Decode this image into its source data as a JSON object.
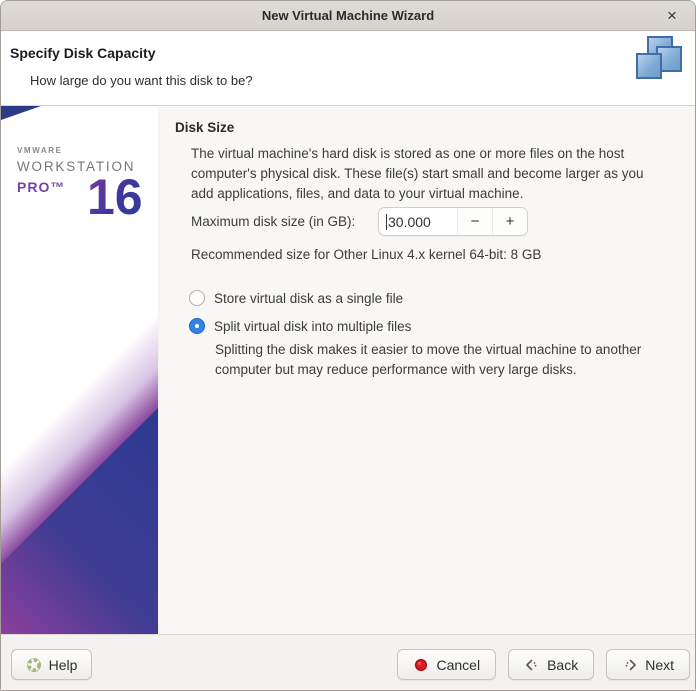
{
  "window": {
    "title": "New Virtual Machine Wizard",
    "close_icon": "×"
  },
  "header": {
    "title": "Specify Disk Capacity",
    "subtitle": "How large do you want this disk to be?"
  },
  "sidebar": {
    "brand_vmware": "VMWARE",
    "brand_workstation": "WORKSTATION",
    "brand_pro": "PRO™",
    "brand_version": "16"
  },
  "content": {
    "section_title": "Disk Size",
    "description": "The virtual machine's hard disk is stored as one or more files on the host\ncomputer's physical disk. These file(s) start small and become larger as you\nadd applications, files, and data to your virtual machine.",
    "max_size_label": "Maximum disk size (in GB):",
    "max_size_value": "30.000",
    "spin_minus": "−",
    "spin_plus": "+",
    "recommended": "Recommended size for Other Linux 4.x kernel 64-bit: 8 GB",
    "radio_single": {
      "label": "Store virtual disk as a single file",
      "selected": false
    },
    "radio_split": {
      "label": "Split virtual disk into multiple files",
      "selected": true
    },
    "split_description": "Splitting the disk makes it easier to move the virtual machine to another\ncomputer but may reduce performance with very large disks."
  },
  "footer": {
    "help_label": "Help",
    "cancel_label": "Cancel",
    "back_label": "Back",
    "next_label": "Next"
  },
  "icons": {
    "header_art": "overlapping-files",
    "help": "lifebuoy",
    "cancel": "red-stop",
    "back": "chevrons-left",
    "next": "chevrons-right"
  },
  "colors": {
    "accent_blue": "#3584e4",
    "cancel_red": "#e01b24",
    "brand_navy": "#2c3a90",
    "brand_purple": "#8d3f9c"
  }
}
